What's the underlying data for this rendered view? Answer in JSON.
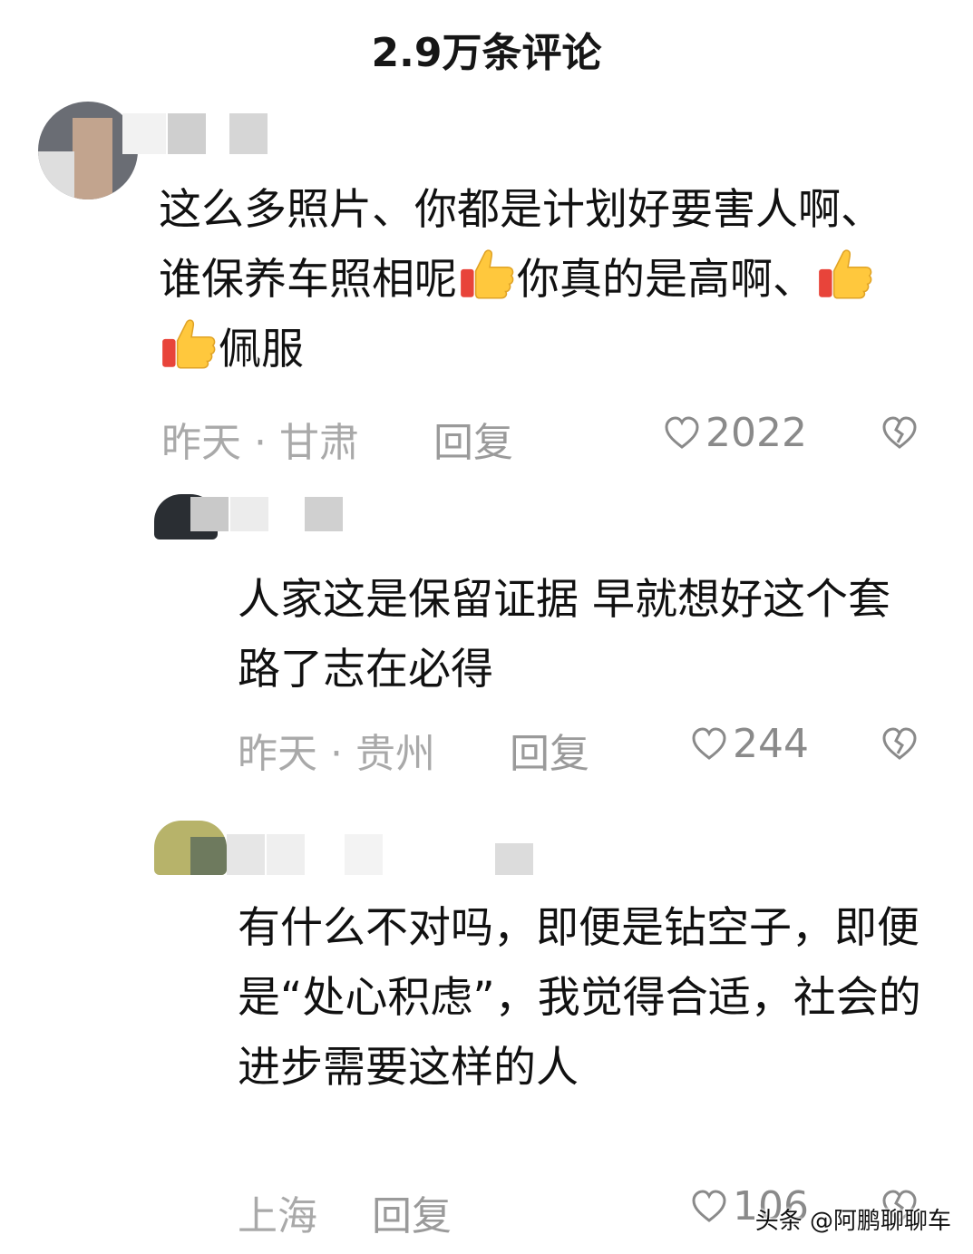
{
  "header": {
    "title": "2.9万条评论"
  },
  "comments": [
    {
      "text_before": "这么多照片、你都是计划好要害人啊、谁保养车照相呢",
      "text_mid": "你真的是高啊、",
      "text_after": "佩服",
      "meta": "昨天 · 甘肃",
      "reply_label": "回复",
      "likes": "2022"
    },
    {
      "text": "人家这是保留证据 早就想好这个套路了志在必得",
      "meta": "昨天 · 贵州",
      "reply_label": "回复",
      "likes": "244"
    },
    {
      "text": "有什么不对吗，即便是钻空子，即便是“处心积虑”，我觉得合适，社会的进步需要这样的人",
      "meta": "上海",
      "reply_label": "回复",
      "likes": "106"
    }
  ],
  "watermark": "头条 @阿鹏聊聊车",
  "icons": {
    "like": "heart-outline-icon",
    "dislike": "broken-heart-icon",
    "emoji": "thumbs-up-emoji"
  },
  "colors": {
    "text": "#111111",
    "meta": "#a9a9a9",
    "icon": "#8a8a8a"
  }
}
